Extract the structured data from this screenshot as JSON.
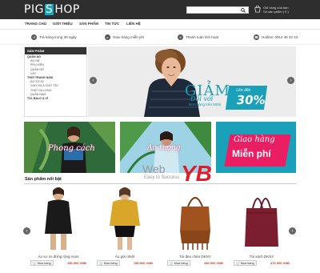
{
  "header": {
    "logo_left": "PIG",
    "logo_s": "S",
    "logo_right": "HOP",
    "search_placeholder": "",
    "cart_line1": "Giỏ hàng của bạn",
    "cart_line2": "Số sản phẩm ( 0 )"
  },
  "nav": {
    "items": [
      "TRANG CHỦ",
      "GIỚI THIỆU",
      "SẢN PHẨM",
      "TIN TỨC",
      "LIÊN HỆ"
    ]
  },
  "features": {
    "items": [
      {
        "text": "Trả hàng trong 30 ngày",
        "icon": "return-icon"
      },
      {
        "text": "Giao hàng miễn phí",
        "icon": "truck-icon"
      },
      {
        "text": "Thanh toán linh hoạt",
        "icon": "payment-icon"
      },
      {
        "text": "Hotline: 0914 46 42 44",
        "icon": "phone-icon"
      }
    ]
  },
  "sidebar": {
    "title": "SẢN PHẨM",
    "rows": [
      {
        "label": "QUẦN ÁO",
        "kind": "cat"
      },
      {
        "label": "ÁO NỮ",
        "kind": "sub"
      },
      {
        "label": "PHỤ KIỆN",
        "kind": "sub"
      },
      {
        "label": "QUẦN NỮ",
        "kind": "sub"
      },
      {
        "label": "VÁY",
        "kind": "sub"
      },
      {
        "label": "THỜI TRANG NAM",
        "kind": "cat"
      },
      {
        "label": "ÁO SƠ MI",
        "kind": "sub"
      },
      {
        "label": "GIÀY DA & GIÀY TÂY",
        "kind": "sub"
      },
      {
        "label": "THẮT DA LƯNG",
        "kind": "sub"
      },
      {
        "label": "QUẦN NAM",
        "kind": "sub"
      },
      {
        "label": "TÚI, BALO & VÍ",
        "kind": "cat"
      }
    ]
  },
  "banner": {
    "headline": "GIẢM",
    "sub": "Đối với",
    "note": "Đơn hàng trên 500k",
    "badge_top": "Lên đến",
    "badge_value": "30%"
  },
  "tiles": [
    {
      "text": "Phong cách"
    },
    {
      "text": "An tượng"
    },
    {
      "text_line1": "Giao hàng",
      "text_line2": "Miễn phí"
    }
  ],
  "watermark": {
    "line1": "Web",
    "line2": "Easy to Success",
    "brand": "YB"
  },
  "featured": {
    "title": "Sản phẩm nổi bật",
    "buy_label": "Mua hàng",
    "products": [
      {
        "name": "Áo sơ mi đứng rộng Asos",
        "price": "190.000 VNĐ"
      },
      {
        "name": "Áo gửi nhiệt",
        "price": "190.000 VNĐ"
      },
      {
        "name": "Túi đeo chéo DKNY",
        "price": "430.000 VNĐ"
      },
      {
        "name": "Túi xách DKNY",
        "price": "470.000 VNĐ"
      }
    ]
  },
  "colors": {
    "accent": "#1aa0b8",
    "header_bg": "#2e2e2e",
    "tile_pink": "#e91e63",
    "price": "#c0392b"
  }
}
